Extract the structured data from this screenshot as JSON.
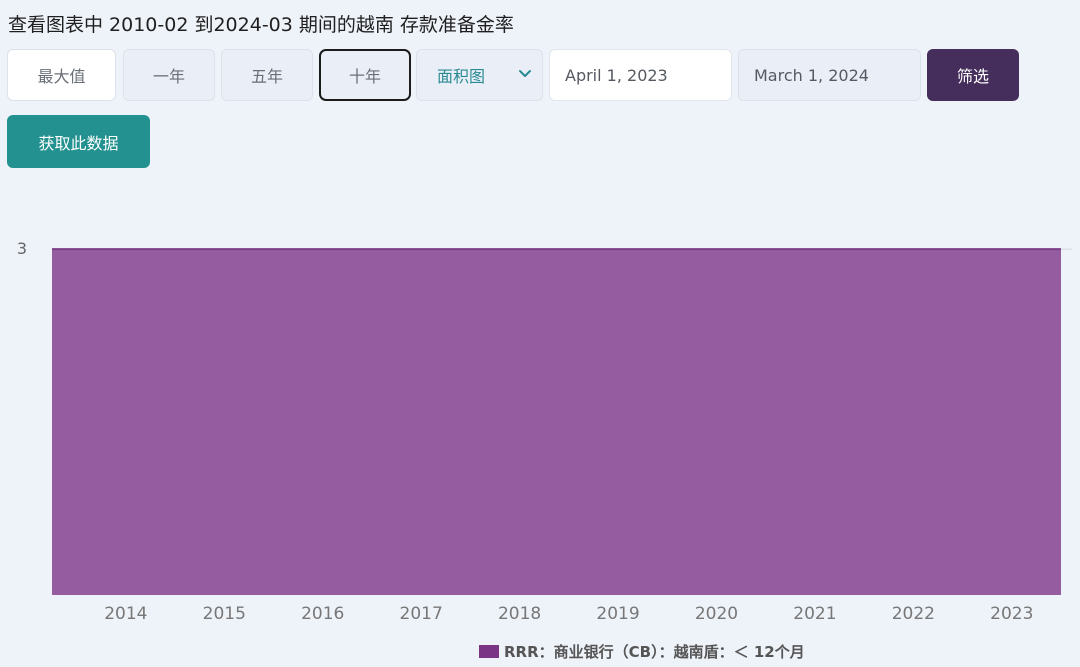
{
  "page": {
    "title": "查看图表中 2010-02 到2024-03 期间的越南 存款准备金率"
  },
  "controls": {
    "range_buttons": [
      {
        "label": "最大值",
        "active": false
      },
      {
        "label": "一年",
        "active": false
      },
      {
        "label": "五年",
        "active": false
      },
      {
        "label": "十年",
        "active": true
      }
    ],
    "chart_type_select": {
      "value": "面积图",
      "icon": "chevron-down-icon"
    },
    "start_date": "April 1, 2023",
    "end_date": "March 1, 2024",
    "filter_label": "筛选",
    "get_data_label": "获取此数据"
  },
  "colors": {
    "series": "#955d9f",
    "series_line": "#7a3f88",
    "legend_swatch": "#7b3585",
    "filter_button": "#462e5c",
    "get_data_button": "#23918f",
    "select_text": "#2a8a92"
  },
  "chart_data": {
    "type": "area",
    "x": [
      "2014",
      "2015",
      "2016",
      "2017",
      "2018",
      "2019",
      "2020",
      "2021",
      "2022",
      "2023"
    ],
    "series": [
      {
        "name": "RRR：商业银行（CB）：越南盾：＜ 12个月",
        "values": [
          3,
          3,
          3,
          3,
          3,
          3,
          3,
          3,
          3,
          3
        ]
      }
    ],
    "y_tick_labels": [
      "3"
    ],
    "x_tick_labels": [
      "2014",
      "2015",
      "2016",
      "2017",
      "2018",
      "2019",
      "2020",
      "2021",
      "2022",
      "2023"
    ],
    "xlim": [
      "2013-08",
      "2023-11"
    ],
    "ylim": [
      2.5,
      3.1
    ],
    "grid": false,
    "legend_placement": "bottom-center"
  }
}
